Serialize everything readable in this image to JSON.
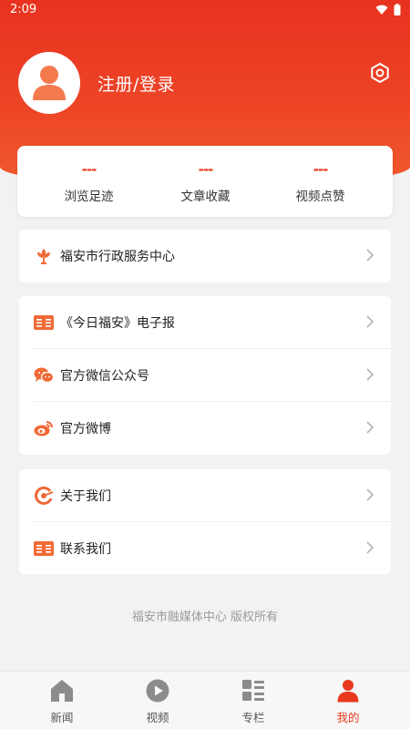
{
  "status_bar": {
    "time": "2:09"
  },
  "profile": {
    "login_text": "注册/登录"
  },
  "stats": [
    {
      "value": "---",
      "label": "浏览足迹"
    },
    {
      "value": "---",
      "label": "文章收藏"
    },
    {
      "value": "---",
      "label": "视频点赞"
    }
  ],
  "menu_group_1": [
    {
      "label": "福安市行政服务中心",
      "icon": "flower-icon"
    }
  ],
  "menu_group_2": [
    {
      "label": "《今日福安》电子报",
      "icon": "newspaper-icon"
    },
    {
      "label": "官方微信公众号",
      "icon": "wechat-icon"
    },
    {
      "label": "官方微博",
      "icon": "weibo-icon"
    }
  ],
  "menu_group_3": [
    {
      "label": "关于我们",
      "icon": "about-logo-icon"
    },
    {
      "label": "联系我们",
      "icon": "contact-book-icon"
    }
  ],
  "footer": {
    "copyright": "福安市融媒体中心 版权所有"
  },
  "tabbar": [
    {
      "label": "新闻",
      "icon": "home-icon"
    },
    {
      "label": "视频",
      "icon": "play-icon"
    },
    {
      "label": "专栏",
      "icon": "columns-icon"
    },
    {
      "label": "我的",
      "icon": "user-icon",
      "active": true
    }
  ],
  "colors": {
    "accent": "#e8391f",
    "header": "#ed4426",
    "icon_orange": "#f06a35"
  }
}
